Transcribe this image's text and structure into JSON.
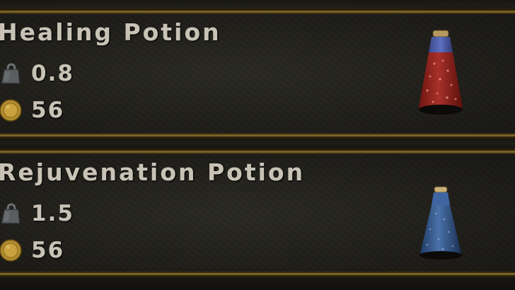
{
  "items": [
    {
      "name": "Healing Potion",
      "weight": "0.8",
      "value": "56",
      "icon": "red-potion-flask-icon",
      "color": "#9e2a22"
    },
    {
      "name": "Rejuvenation Potion",
      "weight": "1.5",
      "value": "56",
      "icon": "blue-potion-flask-icon",
      "color": "#3a5f95"
    }
  ],
  "colors": {
    "frame_gold": "#7a6125",
    "text": "#c8c3b6",
    "background": "#1b1a16"
  }
}
